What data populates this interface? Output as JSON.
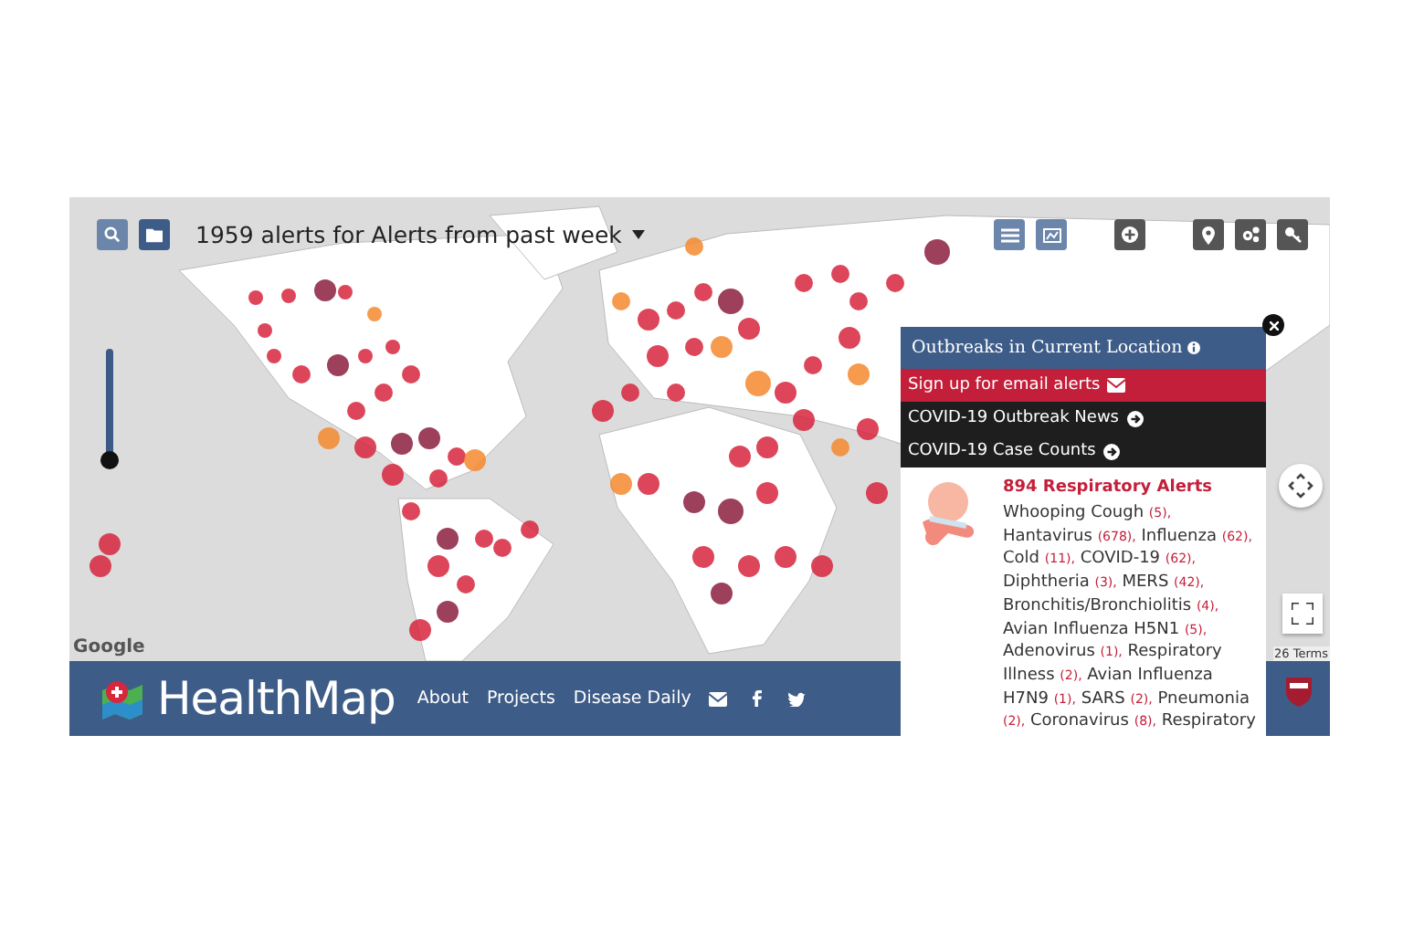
{
  "toolbar": {
    "title": "1959 alerts for Alerts from past week"
  },
  "zoom_slider": {
    "level": 0
  },
  "map": {
    "attribution_logo": "Google",
    "terms": "26 Terms"
  },
  "popup": {
    "title": "Outbreaks in Current Location",
    "menu": [
      {
        "kind": "email",
        "label": "Sign up for email alerts"
      },
      {
        "kind": "link",
        "label": "COVID-19 Outbreak News"
      },
      {
        "kind": "link",
        "label": "COVID-19 Case Counts"
      }
    ],
    "category": "894 Respiratory Alerts",
    "diseases": [
      {
        "name": "Whooping Cough",
        "count": "(5),"
      },
      {
        "name": "Hantavirus",
        "count": "(678),"
      },
      {
        "name": "Influenza",
        "count": "(62),"
      },
      {
        "name": "Cold",
        "count": "(11),"
      },
      {
        "name": "COVID-19",
        "count": "(62),"
      },
      {
        "name": "Diphtheria",
        "count": "(3),"
      },
      {
        "name": "MERS",
        "count": "(42),"
      },
      {
        "name": "Bronchitis/Bronchiolitis",
        "count": "(4),"
      },
      {
        "name": "Avian Influenza H5N1",
        "count": "(5),"
      },
      {
        "name": "Adenovirus",
        "count": "(1),"
      },
      {
        "name": "Respiratory Illness",
        "count": "(2),"
      },
      {
        "name": "Avian Influenza H7N9",
        "count": "(1),"
      },
      {
        "name": "SARS",
        "count": "(2),"
      },
      {
        "name": "Pneumonia",
        "count": "(2),"
      },
      {
        "name": "Coronavirus",
        "count": "(8),"
      },
      {
        "name": "Respiratory"
      }
    ]
  },
  "footer": {
    "brand": "HealthMap",
    "links": [
      "About",
      "Projects",
      "Disease Daily"
    ]
  }
}
